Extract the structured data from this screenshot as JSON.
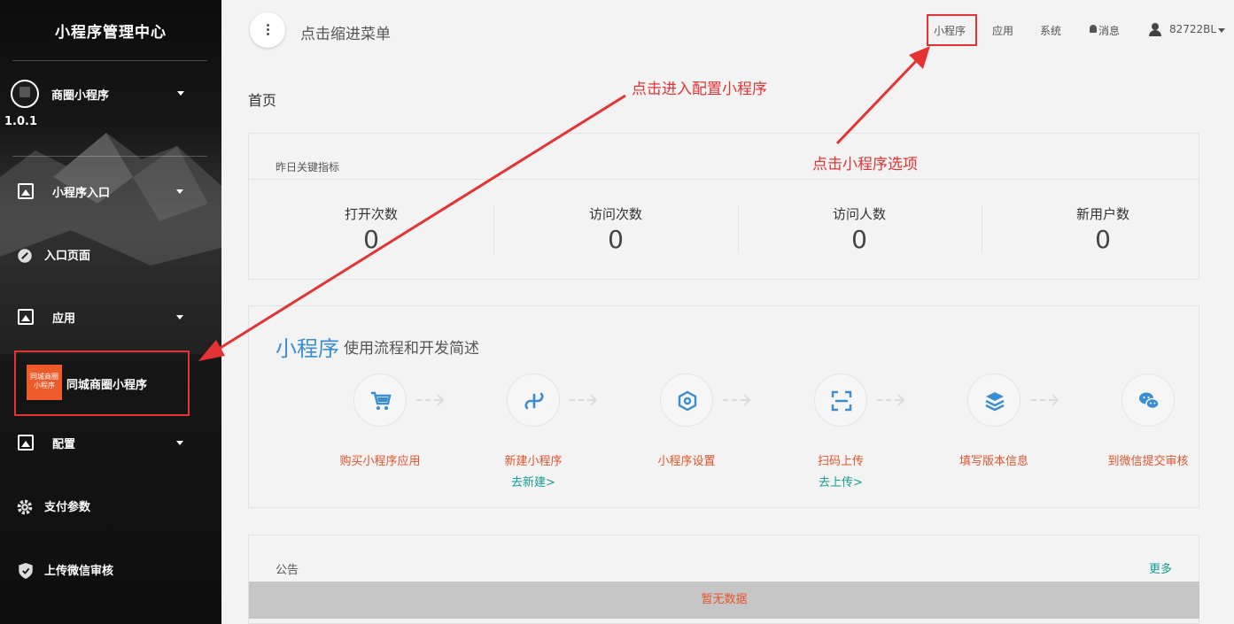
{
  "sidebar": {
    "title": "小程序管理中心",
    "account_name": "商圈小程序",
    "version": "1.0.1",
    "items": [
      {
        "label": "小程序入口",
        "icon": "image-icon"
      },
      {
        "label": "入口页面",
        "icon": "link-icon"
      },
      {
        "label": "应用",
        "icon": "image-icon"
      },
      {
        "label": "配置",
        "icon": "image-icon"
      },
      {
        "label": "支付参数",
        "icon": "gear-icon"
      },
      {
        "label": "上传微信审核",
        "icon": "shield-icon"
      }
    ],
    "sub_app": {
      "thumb_text_1": "同城商圈",
      "thumb_text_2": "小程序",
      "label": "同城商圈小程序",
      "thumb_color": "#ef5a2a"
    }
  },
  "topbar": {
    "menu_label": "点击缩进菜单",
    "links": [
      "小程序",
      "应用",
      "系统",
      "消息"
    ],
    "username": "82722BL"
  },
  "page_title": "首页",
  "stats": {
    "header": "昨日关键指标",
    "items": [
      {
        "label": "打开次数",
        "value": "0"
      },
      {
        "label": "访问次数",
        "value": "0"
      },
      {
        "label": "访问人数",
        "value": "0"
      },
      {
        "label": "新用户数",
        "value": "0"
      }
    ]
  },
  "flow": {
    "title": "小程序",
    "subtitle": "使用流程和开发简述",
    "steps": [
      {
        "label": "购买小程序应用",
        "action": "",
        "icon": "cart-icon"
      },
      {
        "label": "新建小程序",
        "action": "去新建>",
        "icon": "link-icon"
      },
      {
        "label": "小程序设置",
        "action": "",
        "icon": "hexagon-icon"
      },
      {
        "label": "扫码上传",
        "action": "去上传>",
        "icon": "scan-icon"
      },
      {
        "label": "填写版本信息",
        "action": "",
        "icon": "layers-icon"
      },
      {
        "label": "到微信提交审核",
        "action": "",
        "icon": "wechat-icon"
      }
    ]
  },
  "notice": {
    "title": "公告",
    "more": "更多",
    "empty": "暂无数据"
  },
  "annotations": {
    "config": "点击进入配置小程序",
    "miniprogram": "点击小程序选项"
  },
  "colors": {
    "accent_blue": "#3a8dd1",
    "accent_orange": "#e4542c",
    "accent_teal": "#139e8f",
    "annotation_red": "#e53333"
  }
}
